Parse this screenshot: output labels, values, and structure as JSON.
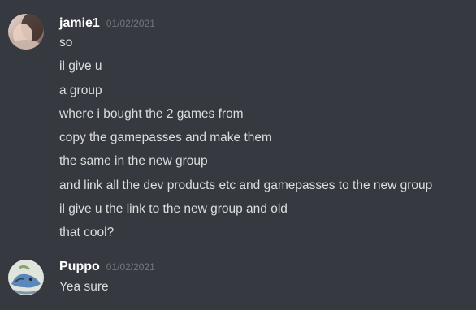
{
  "messages": [
    {
      "username": "jamie1",
      "timestamp": "01/02/2021",
      "avatar_icon": "user-avatar-photo",
      "lines": [
        "so",
        "il give u",
        "a group",
        "where i bought the 2 games from",
        "copy the gamepasses and make them",
        "the same in the new group",
        "and link all the dev products etc and gamepasses to the new group",
        "il give u the link to the new group and old",
        "that cool?"
      ]
    },
    {
      "username": "Puppo",
      "timestamp": "01/02/2021",
      "avatar_icon": "user-avatar-drawing",
      "lines": [
        "Yea sure"
      ]
    }
  ],
  "colors": {
    "background": "#36393f",
    "username": "#ffffff",
    "timestamp": "#72767d",
    "message_text": "#dcddde"
  }
}
